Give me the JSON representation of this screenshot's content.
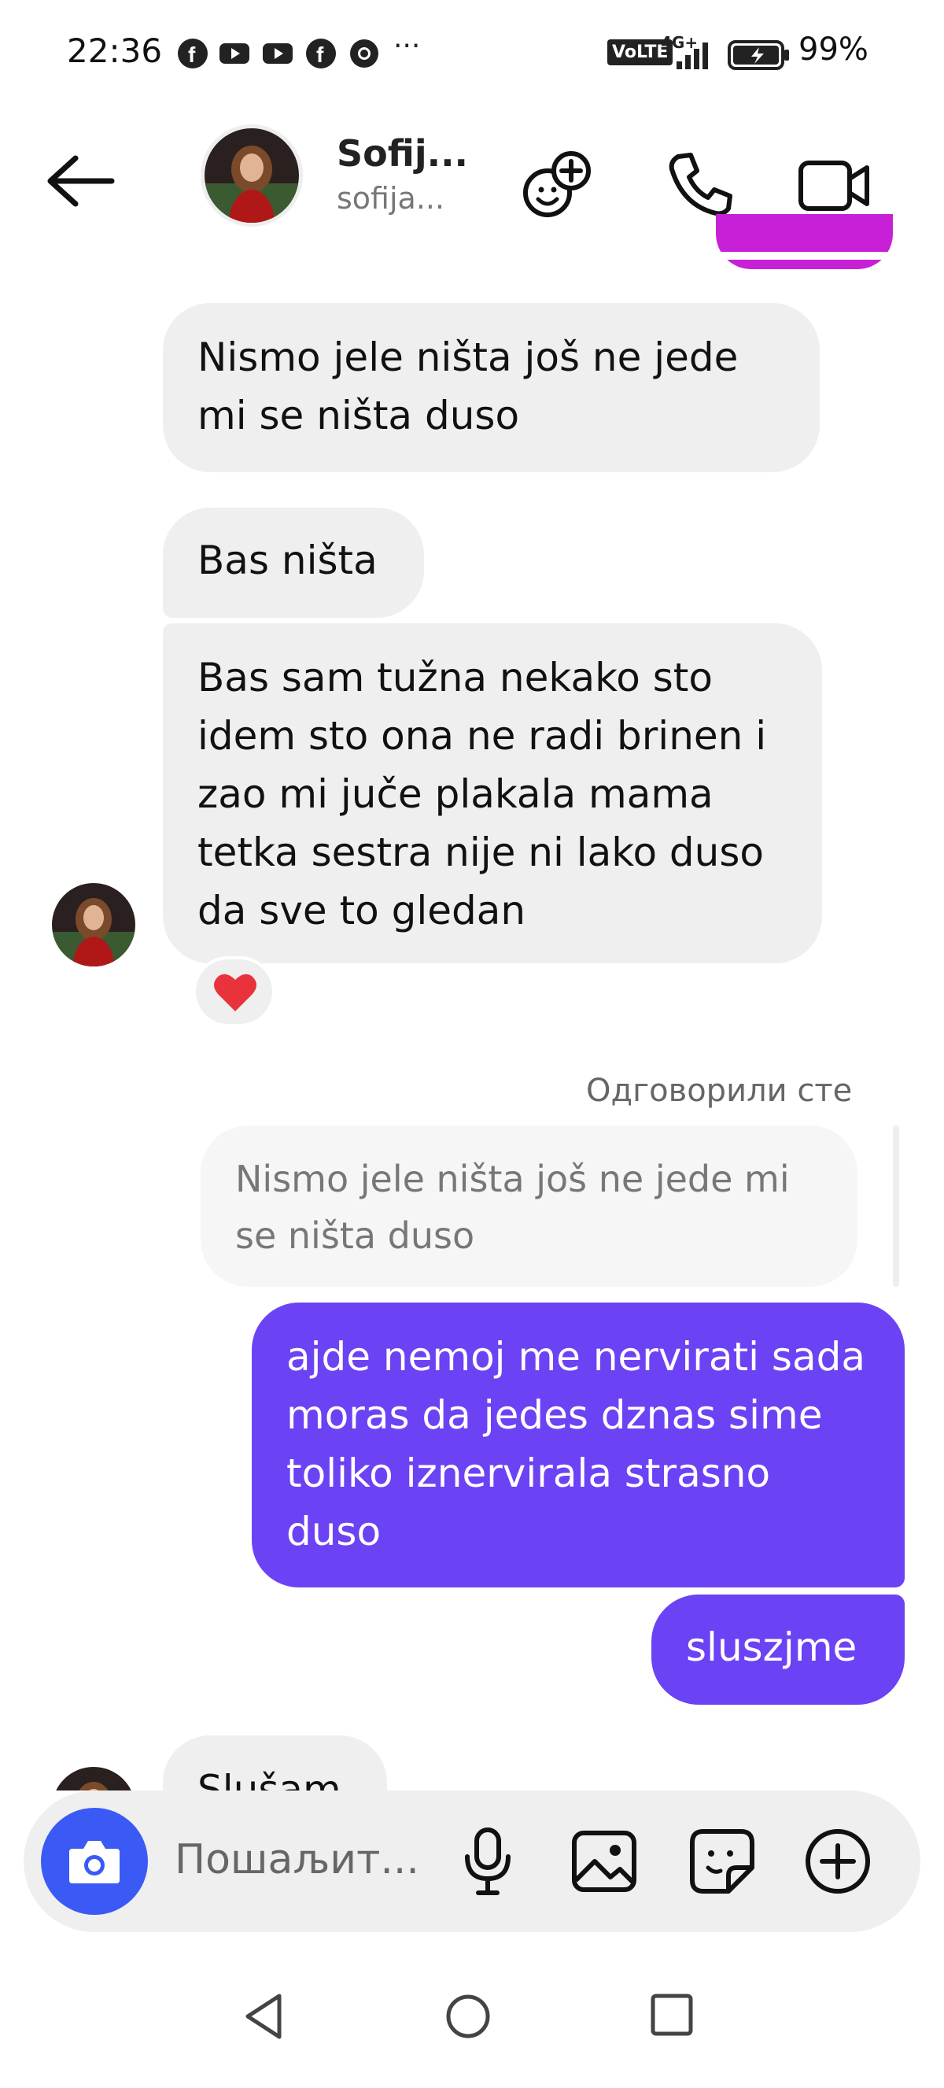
{
  "status_bar": {
    "time": "22:36",
    "icons": [
      "facebook-icon",
      "youtube-icon",
      "youtube-icon",
      "facebook-icon",
      "chrome-icon"
    ],
    "more": "···",
    "network": "VoLTE",
    "signal": "4G+",
    "battery": "99%"
  },
  "header": {
    "name": "Sofij...",
    "handle": "sofija...",
    "icons": [
      "back-arrow-icon",
      "add-emoji-icon",
      "phone-icon",
      "video-call-icon"
    ]
  },
  "messages": [
    {
      "side": "left",
      "text": "Nismo jele ništa još ne jede mi se ništa duso"
    },
    {
      "side": "left",
      "text": "Bas ništa"
    },
    {
      "side": "left",
      "text": "Bas sam tužna nekako sto idem sto ona ne radi brinen i zao mi juče plakala mama tetka sestra nije ni lako duso da sve to gledan",
      "reaction": "❤️"
    },
    {
      "side": "meta",
      "text": "Одговорили сте"
    },
    {
      "side": "quote",
      "text": "Nismo jele ništa još ne jede mi se ništa duso"
    },
    {
      "side": "right",
      "text": "ajde nemoj me nervirati sada moras da jedes dznas sime toliko iznervirala strasno duso"
    },
    {
      "side": "right",
      "text": "sluszjme"
    },
    {
      "side": "left",
      "text": "Slušam"
    }
  ],
  "composer": {
    "placeholder": "Пошаљит..."
  },
  "colors": {
    "accent": "#6c42f5",
    "camera": "#3b5af5",
    "incoming": "#efefef",
    "heart": "#e8323c"
  }
}
